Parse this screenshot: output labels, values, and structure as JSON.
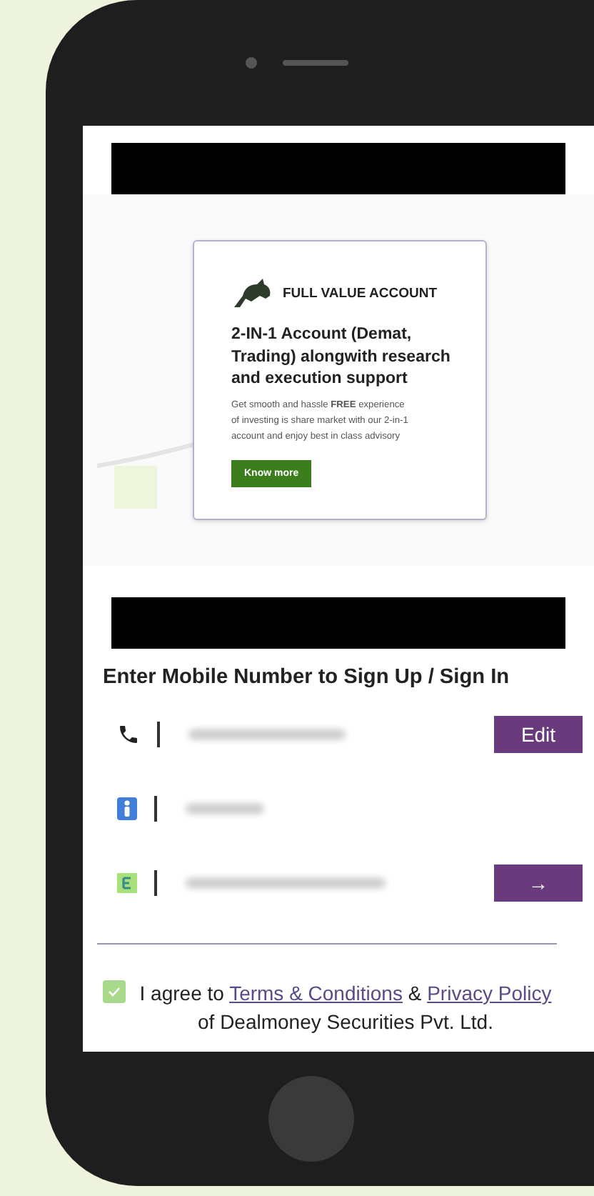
{
  "banner": {
    "card": {
      "title": "FULL VALUE ACCOUNT",
      "headline": "2-IN-1 Account (Demat, Trading) alongwith research and execution support",
      "body": "Get smooth and hassle **FREE** experience of investing is share market with our 2-in-1 account and enjoy best in class advisory",
      "button": "Know more"
    }
  },
  "signup": {
    "heading": "Enter Mobile Number to Sign Up / Sign In",
    "fields": [
      {
        "kind": "phone",
        "action": "Edit"
      },
      {
        "kind": "name"
      },
      {
        "kind": "email",
        "action": "→"
      }
    ]
  },
  "consent": {
    "checked": true,
    "prefix": "I agree to",
    "terms_link": "Terms & Conditions",
    "joiner": "&",
    "privacy_link": "Privacy Policy",
    "suffix": "of Dealmoney Securities Pvt. Ltd."
  }
}
